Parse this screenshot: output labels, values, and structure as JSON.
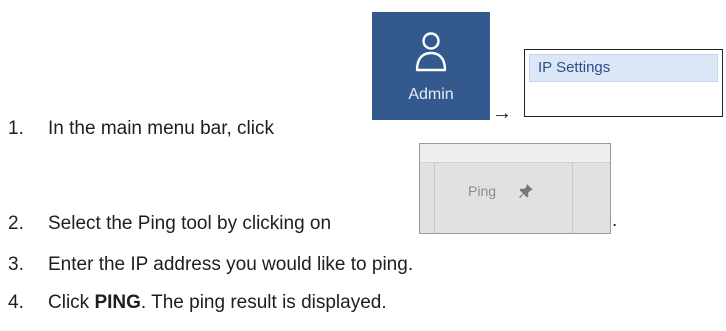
{
  "steps": [
    {
      "num": "1.",
      "text": "In the main menu bar, click"
    },
    {
      "num": "2.",
      "text": "Select the Ping tool by clicking on"
    },
    {
      "num": "3.",
      "text": "Enter the IP address you would like to ping."
    },
    {
      "num": "4.",
      "text_before": "Click ",
      "bold": "PING",
      "text_after": ". The ping result is displayed."
    }
  ],
  "admin_tile": {
    "label": "Admin",
    "icon": "user-icon",
    "color": "#34598f"
  },
  "arrow": "→",
  "ip_settings": {
    "label": "IP Settings",
    "highlight_color": "#dbe7f7"
  },
  "ping_button": {
    "label": "Ping",
    "icon": "pin-icon"
  },
  "step2_period": "."
}
